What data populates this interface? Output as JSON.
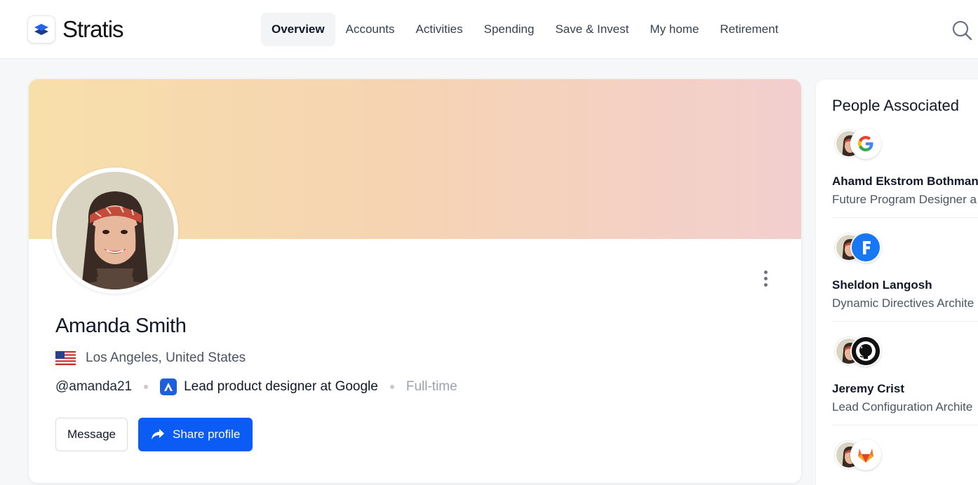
{
  "app": {
    "name": "Stratis"
  },
  "nav": {
    "items": [
      {
        "label": "Overview",
        "active": true
      },
      {
        "label": "Accounts",
        "active": false
      },
      {
        "label": "Activities",
        "active": false
      },
      {
        "label": "Spending",
        "active": false
      },
      {
        "label": "Save & Invest",
        "active": false
      },
      {
        "label": "My home",
        "active": false
      },
      {
        "label": "Retirement",
        "active": false
      }
    ]
  },
  "profile": {
    "name": "Amanda Smith",
    "location": "Los Angeles, United States",
    "handle": "@amanda21",
    "role": "Lead product designer at Google",
    "employment_type": "Full-time",
    "buttons": {
      "message": "Message",
      "share": "Share profile"
    }
  },
  "people": {
    "title": "People Associated",
    "items": [
      {
        "name": "Ahamd Ekstrom Bothman",
        "role": "Future Program Designer a",
        "company_icon": "google-icon"
      },
      {
        "name": "Sheldon Langosh",
        "role": "Dynamic Directives Archite",
        "company_icon": "facebook-icon"
      },
      {
        "name": "Jeremy Crist",
        "role": "Lead Configuration Archite",
        "company_icon": "github-icon"
      },
      {
        "name": "",
        "role": "",
        "company_icon": "gitlab-icon"
      }
    ]
  },
  "colors": {
    "primary": "#0a5cf5",
    "banner_start": "#f7dfaa",
    "banner_end": "#f2cfcf",
    "text": "#111827",
    "muted": "#4b5563"
  }
}
